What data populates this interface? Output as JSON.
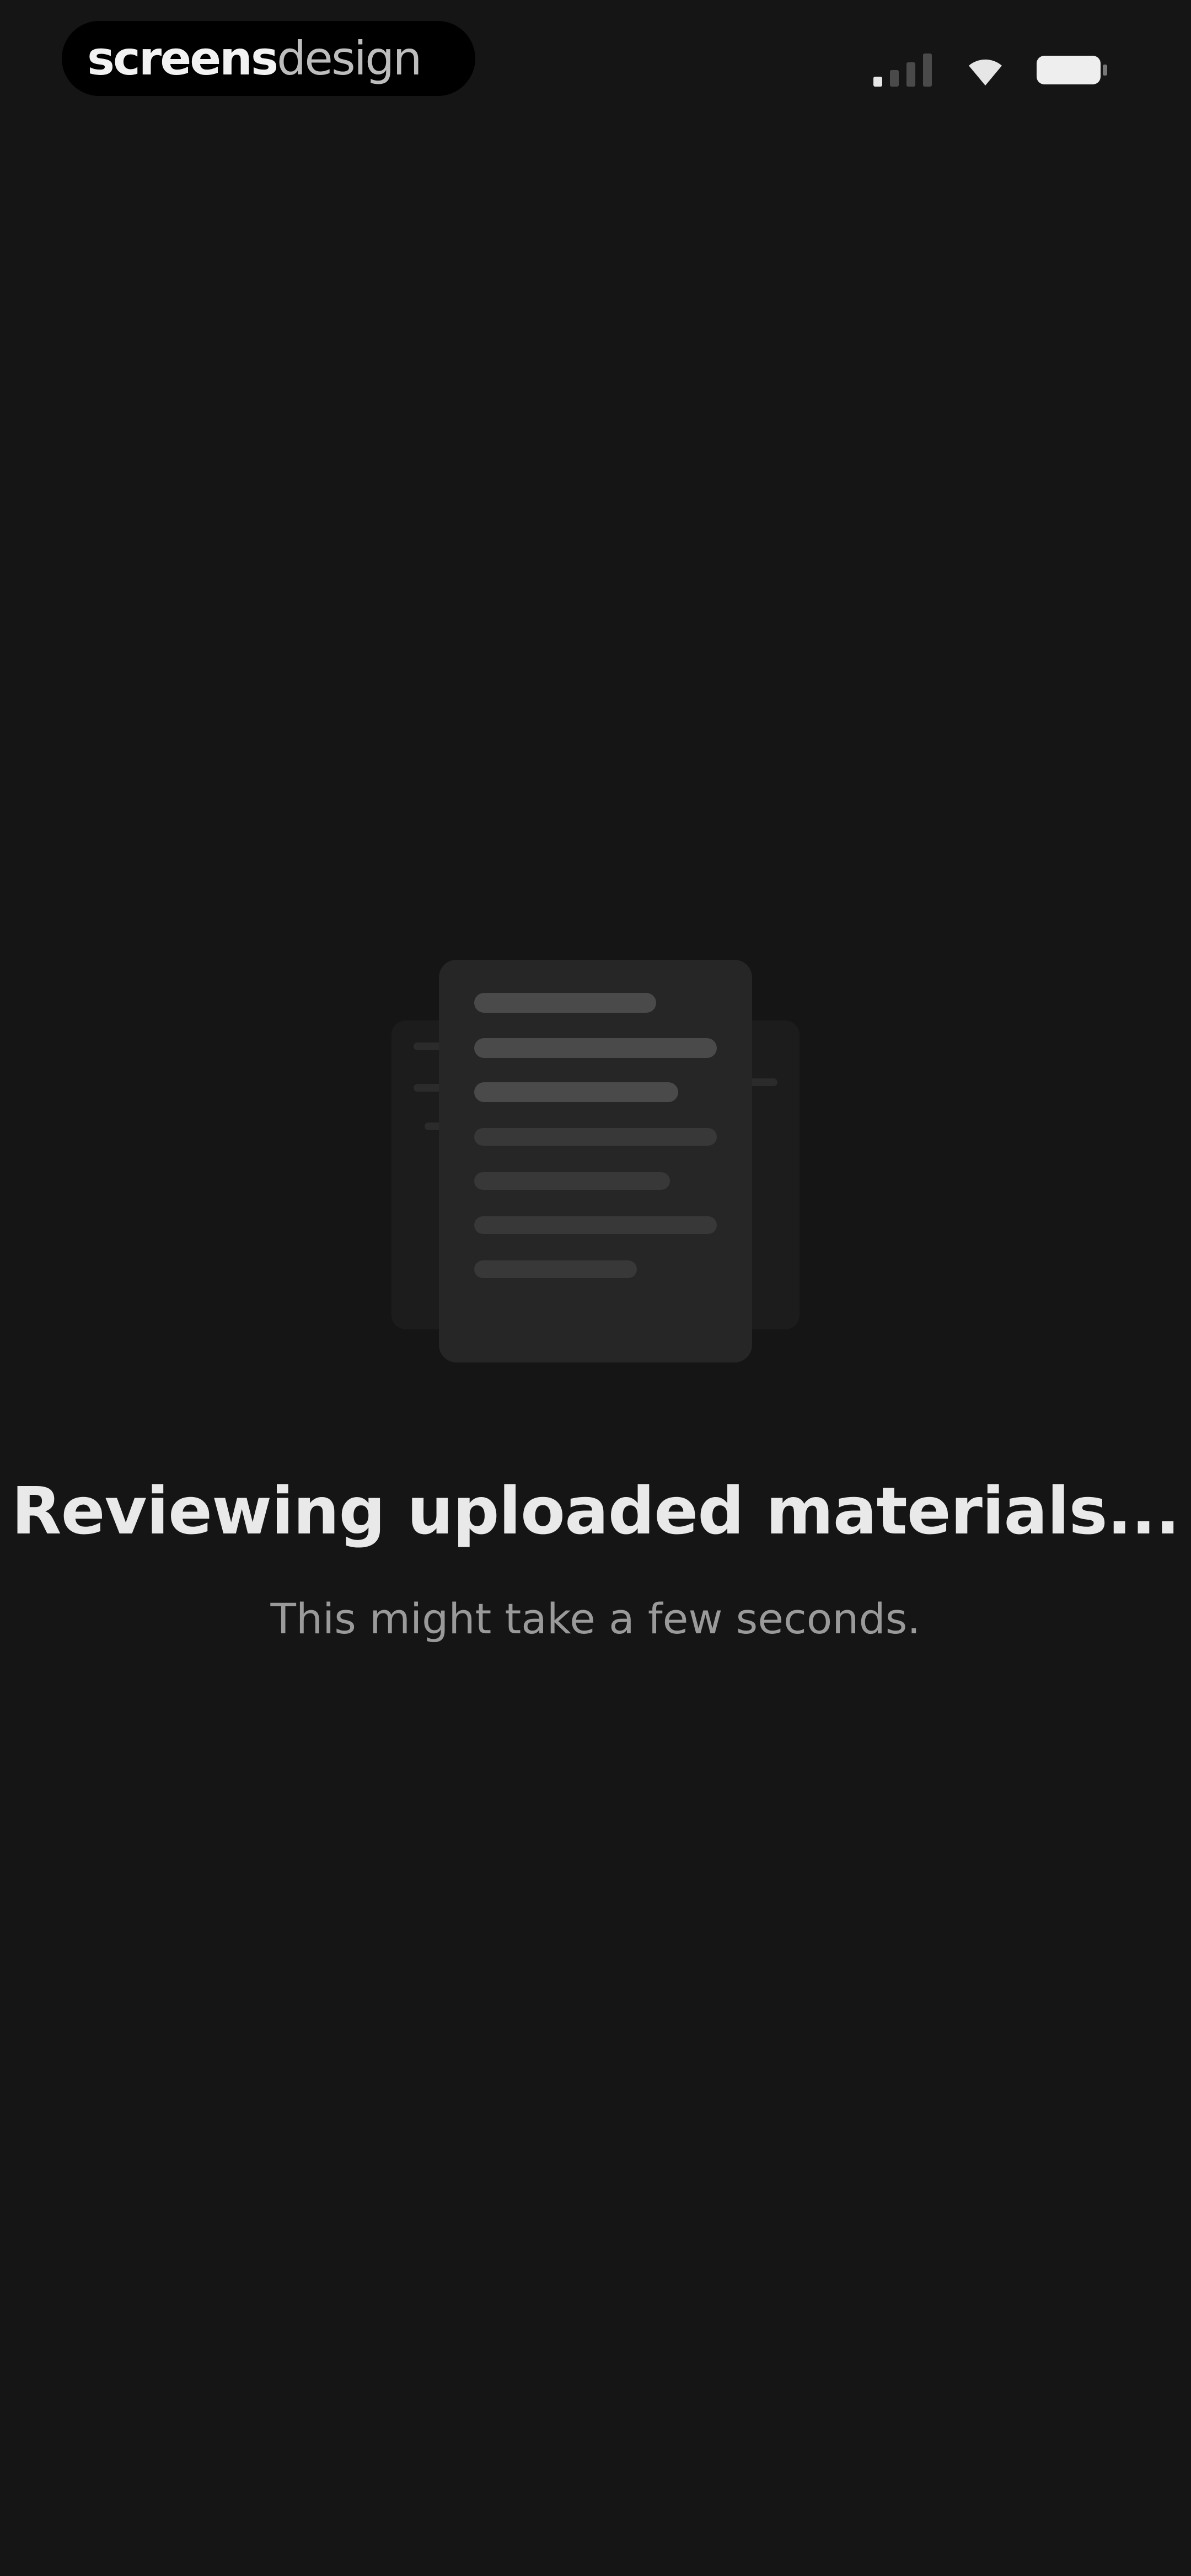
{
  "status_bar": {
    "brand": {
      "part_bold": "screens",
      "part_light": "design"
    },
    "icons": [
      "signal-icon",
      "wifi-icon",
      "battery-icon"
    ]
  },
  "loading": {
    "title": "Reviewing uploaded materials...",
    "subtitle": "This might take a few seconds.",
    "illustration": "documents-icon"
  },
  "colors": {
    "background": "#151515",
    "title": "#e9e9e9",
    "subtitle": "#9a9a9a",
    "document_card": "#262626"
  }
}
